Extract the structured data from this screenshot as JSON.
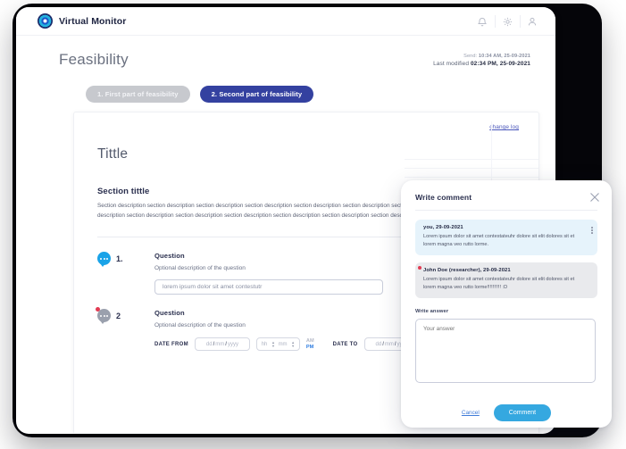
{
  "app": {
    "brand_name": "Virtual Monitor",
    "logo_icon": "eye-logo-icon",
    "topbar_icons": [
      {
        "name": "notification-bell-icon",
        "glyph": "bell"
      },
      {
        "name": "settings-gear-icon",
        "glyph": "gear"
      },
      {
        "name": "user-account-icon",
        "glyph": "user"
      }
    ]
  },
  "header": {
    "title": "Feasibility",
    "send_prefix": "Send:",
    "send_value": "10:34 AM, 25-09-2021",
    "modified_prefix": "Last modified",
    "modified_value": "02:34 PM, 25-09-2021"
  },
  "tabs": [
    {
      "label": "1. First part of feasibility",
      "active": false
    },
    {
      "label": "2. Second part of feasibility",
      "active": true
    }
  ],
  "document": {
    "changelog_link": "change log",
    "title": "Tittle",
    "section_title": "Section tittle",
    "section_body": "Section description section description section description section description section description section description section description section description section description section description section description section description section description"
  },
  "questions": [
    {
      "number": "1.",
      "badge_icon": "comment-bubble-icon",
      "title": "Question",
      "description": "Optional description of the question",
      "input_value": "lorem ipsum dolor sit amet contestutr"
    },
    {
      "number": "2",
      "badge_icon": "comment-bubble-icon-unread",
      "title": "Question",
      "description": "Optional description of the question",
      "date_from_label": "DATE FROM",
      "date_to_label": "DATE TO",
      "date_placeholder_day": "dd",
      "date_placeholder_month": "mm",
      "date_placeholder_year": "yyyy",
      "date_separator": "/",
      "time_placeholder_hour": "hh",
      "time_placeholder_minute": "mm",
      "am_label": "AM",
      "pm_label": "PM"
    }
  ],
  "comment_panel": {
    "title": "Write comment",
    "close_icon": "close-icon",
    "comments": [
      {
        "author_date": "you, 29-09-2021",
        "body": "Lorem ipsum dolor sit amet contestateuhr dolore sit elit dolores sit et lorem magna veo rutto lorme.",
        "own": true
      },
      {
        "author_date": "John Doe (researcher), 29-09-2021",
        "body": "Lorem ipsum dolor sit amet contestateuhr dolore sit elit dolores sit et lorem magna veo rutto lorme!!!!!!!!!! :D",
        "own": false
      }
    ],
    "answer_label": "Write answer",
    "answer_placeholder": "Your answer",
    "cancel_label": "Cancel",
    "submit_label": "Comment"
  }
}
